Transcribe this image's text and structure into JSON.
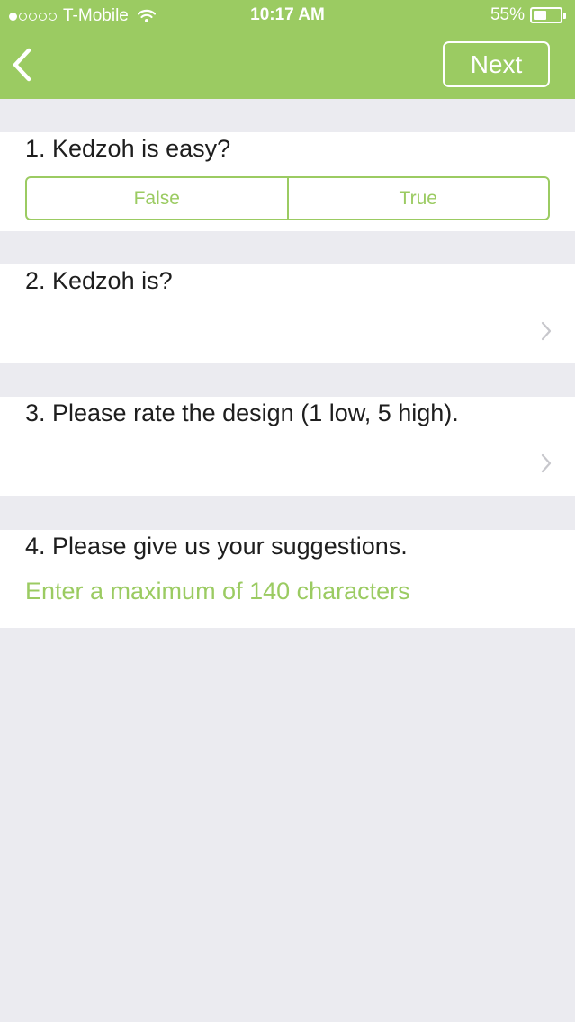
{
  "status_bar": {
    "carrier": "T-Mobile",
    "time": "10:17 AM",
    "battery": "55%",
    "battery_level": 0.55,
    "signal_bars_filled": 1,
    "signal_bars_total": 5
  },
  "nav": {
    "back_icon": "chevron-left-icon",
    "next_label": "Next"
  },
  "questions": [
    {
      "title": "1. Kedzoh is easy?",
      "options": [
        "False",
        "True"
      ]
    },
    {
      "title": "2. Kedzoh is?",
      "icon": "chevron-right-icon"
    },
    {
      "title": "3. Please rate the design (1 low, 5 high).",
      "icon": "chevron-right-icon"
    },
    {
      "title": "4. Please give us your suggestions.",
      "input_value": "",
      "placeholder": "Enter a maximum of 140 characters"
    }
  ],
  "colors": {
    "accent": "#9BCB62",
    "background": "#EBEBF0",
    "card": "#FFFFFF",
    "text": "#1E1E1E",
    "chevron": "#C7C7CC"
  }
}
